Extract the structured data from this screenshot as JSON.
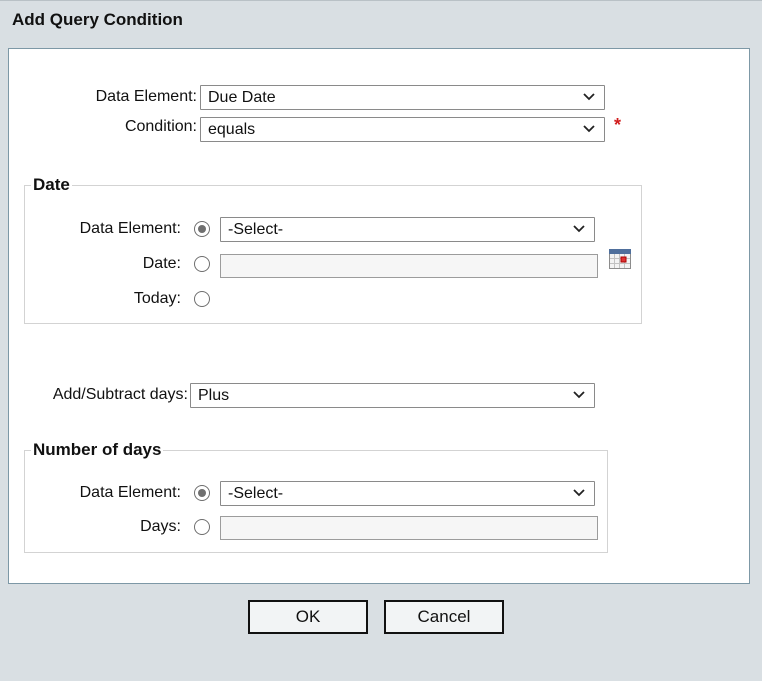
{
  "dialog": {
    "title": "Add Query Condition"
  },
  "main": {
    "data_element_label": "Data Element:",
    "data_element_value": "Due Date",
    "condition_label": "Condition:",
    "condition_value": "equals",
    "required_marker": "*"
  },
  "date_group": {
    "legend": "Date",
    "data_element_label": "Data Element:",
    "data_element_select_value": "-Select-",
    "data_element_radio_checked": true,
    "date_label": "Date:",
    "date_value": "",
    "date_radio_checked": false,
    "today_label": "Today:",
    "today_radio_checked": false,
    "calendar_icon": "calendar-icon"
  },
  "add_subtract": {
    "label": "Add/Subtract days:",
    "value": "Plus"
  },
  "days_group": {
    "legend": "Number of days",
    "data_element_label": "Data Element:",
    "data_element_select_value": "-Select-",
    "data_element_radio_checked": true,
    "days_label": "Days:",
    "days_value": "",
    "days_radio_checked": false
  },
  "buttons": {
    "ok": "OK",
    "cancel": "Cancel"
  },
  "icons": {
    "dropdown": "chevron-down-icon"
  }
}
